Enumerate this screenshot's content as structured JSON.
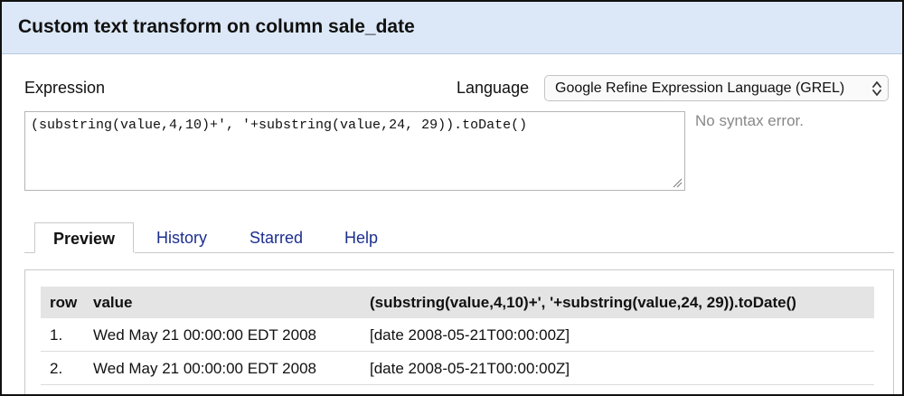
{
  "dialog": {
    "title": "Custom text transform on column sale_date"
  },
  "expression": {
    "label": "Expression",
    "value": "(substring(value,4,10)+', '+substring(value,24, 29)).toDate()",
    "status": "No syntax error."
  },
  "language": {
    "label": "Language",
    "selected": "Google Refine Expression Language (GREL)"
  },
  "tabs": [
    {
      "label": "Preview",
      "active": true
    },
    {
      "label": "History",
      "active": false
    },
    {
      "label": "Starred",
      "active": false
    },
    {
      "label": "Help",
      "active": false
    }
  ],
  "preview": {
    "columns": [
      "row",
      "value",
      "(substring(value,4,10)+', '+substring(value,24, 29)).toDate()"
    ],
    "rows": [
      {
        "row": "1.",
        "value": "Wed May 21 00:00:00 EDT 2008",
        "result": "[date 2008-05-21T00:00:00Z]"
      },
      {
        "row": "2.",
        "value": "Wed May 21 00:00:00 EDT 2008",
        "result": "[date 2008-05-21T00:00:00Z]"
      }
    ]
  },
  "colors": {
    "title_bar": "#dce8f7",
    "link": "#1c2f8f",
    "header_bg": "#e4e4e4",
    "muted_text": "#888888"
  }
}
